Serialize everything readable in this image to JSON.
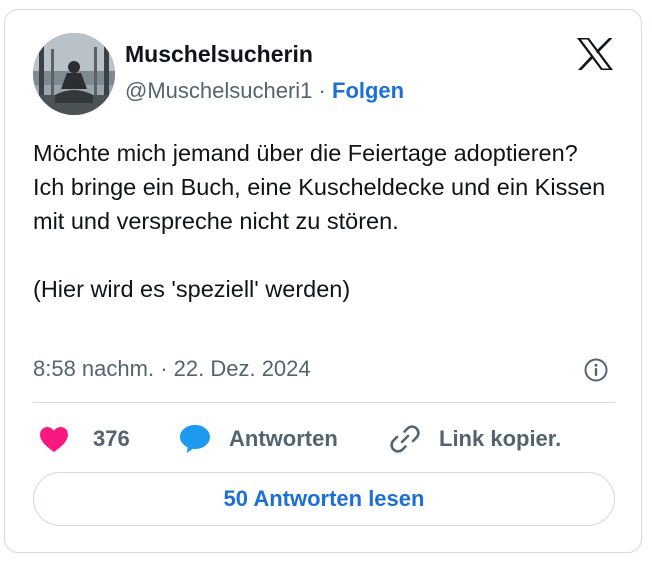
{
  "author": {
    "display_name": "Muschelsucherin",
    "handle": "@Muschelsucheri1",
    "separator": "·",
    "follow_label": "Folgen"
  },
  "tweet": {
    "lines": [
      "Möchte mich jemand über die Feiertage adoptieren?",
      "Ich bringe ein Buch, eine Kuscheldecke und ein Kissen mit und verspreche nicht zu stören.",
      "(Hier wird es 'speziell' werden)"
    ],
    "time": "8:58 nachm.",
    "separator": "·",
    "date": "22. Dez. 2024"
  },
  "actions": {
    "like_count": "376",
    "reply_label": "Antworten",
    "copy_link_label": "Link kopier."
  },
  "read_replies_label": "50 Antworten lesen",
  "icons": {
    "brand": "x-logo-icon",
    "info": "info-icon",
    "like": "heart-icon",
    "reply": "speech-bubble-icon",
    "copy": "link-icon"
  },
  "colors": {
    "link_blue": "#1d6fd8",
    "like_pink": "#f91880",
    "reply_blue": "#1d9bf0",
    "muted_text": "#536471",
    "border": "#cfd9de"
  }
}
